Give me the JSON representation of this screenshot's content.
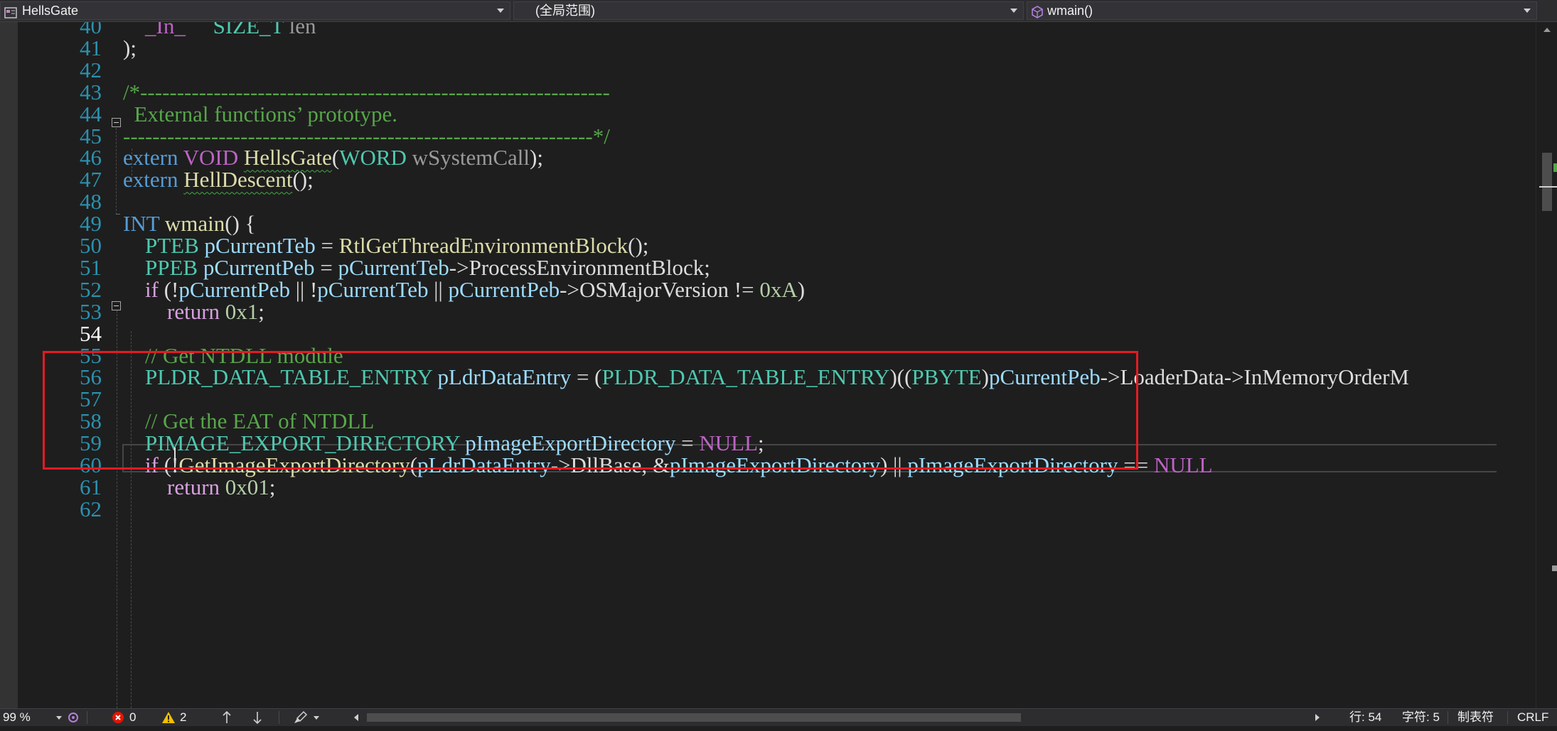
{
  "navbar": {
    "project": "HellsGate",
    "scope": "(全局范围)",
    "member": "wmain()"
  },
  "line_numbers": [
    "40",
    "41",
    "42",
    "43",
    "44",
    "45",
    "46",
    "47",
    "48",
    "49",
    "50",
    "51",
    "52",
    "53",
    "54",
    "55",
    "56",
    "57",
    "58",
    "59",
    "60",
    "61",
    "62"
  ],
  "current_line": "54",
  "code": [
    [
      {
        "t": "    _In_     ",
        "c": "macro"
      },
      {
        "t": "SIZE_T",
        "c": "type"
      },
      {
        "t": " len",
        "c": "param"
      }
    ],
    [
      {
        "t": ");",
        "c": "plain"
      }
    ],
    [],
    [
      {
        "t": "/*----------------------------------------------------------------",
        "c": "com"
      }
    ],
    [
      {
        "t": "  External functions’ prototype.",
        "c": "com"
      }
    ],
    [
      {
        "t": "----------------------------------------------------------------*/",
        "c": "com"
      }
    ],
    [
      {
        "t": "extern ",
        "c": "kw"
      },
      {
        "t": "VOID ",
        "c": "macro"
      },
      {
        "t": "HellsGate",
        "c": "func",
        "sq": true
      },
      {
        "t": "(",
        "c": "plain"
      },
      {
        "t": "WORD",
        "c": "type"
      },
      {
        "t": " wSystemCall",
        "c": "param"
      },
      {
        "t": ");",
        "c": "plain"
      }
    ],
    [
      {
        "t": "extern ",
        "c": "kw"
      },
      {
        "t": "HellDescent",
        "c": "func",
        "sq": true
      },
      {
        "t": "();",
        "c": "plain"
      }
    ],
    [],
    [
      {
        "t": "INT ",
        "c": "kw"
      },
      {
        "t": "wmain",
        "c": "func"
      },
      {
        "t": "() {",
        "c": "plain"
      }
    ],
    [
      {
        "t": "    PTEB ",
        "c": "type"
      },
      {
        "t": "pCurrentTeb",
        "c": "var"
      },
      {
        "t": " = ",
        "c": "plain"
      },
      {
        "t": "RtlGetThreadEnvironmentBlock",
        "c": "func"
      },
      {
        "t": "();",
        "c": "plain"
      }
    ],
    [
      {
        "t": "    PPEB ",
        "c": "type"
      },
      {
        "t": "pCurrentPeb",
        "c": "var"
      },
      {
        "t": " = ",
        "c": "plain"
      },
      {
        "t": "pCurrentTeb",
        "c": "var"
      },
      {
        "t": "->",
        "c": "plain"
      },
      {
        "t": "ProcessEnvironmentBlock",
        "c": "plain"
      },
      {
        "t": ";",
        "c": "plain"
      }
    ],
    [
      {
        "t": "    if ",
        "c": "ctrl"
      },
      {
        "t": "(!",
        "c": "plain"
      },
      {
        "t": "pCurrentPeb",
        "c": "var"
      },
      {
        "t": " || !",
        "c": "plain"
      },
      {
        "t": "pCurrentTeb",
        "c": "var"
      },
      {
        "t": " || ",
        "c": "plain"
      },
      {
        "t": "pCurrentPeb",
        "c": "var"
      },
      {
        "t": "->OSMajorVersion != ",
        "c": "plain"
      },
      {
        "t": "0xA",
        "c": "num"
      },
      {
        "t": ")",
        "c": "plain"
      }
    ],
    [
      {
        "t": "        return ",
        "c": "ctrl"
      },
      {
        "t": "0x1",
        "c": "num"
      },
      {
        "t": ";",
        "c": "plain"
      }
    ],
    [],
    [
      {
        "t": "    // Get NTDLL module",
        "c": "com"
      }
    ],
    [
      {
        "t": "    PLDR_DATA_TABLE_ENTRY ",
        "c": "type"
      },
      {
        "t": "pLdrDataEntry",
        "c": "var"
      },
      {
        "t": " = (",
        "c": "plain"
      },
      {
        "t": "PLDR_DATA_TABLE_ENTRY",
        "c": "type"
      },
      {
        "t": ")((",
        "c": "plain"
      },
      {
        "t": "PBYTE",
        "c": "type"
      },
      {
        "t": ")",
        "c": "plain"
      },
      {
        "t": "pCurrentPeb",
        "c": "var"
      },
      {
        "t": "->LoaderData->InMemoryOrderM",
        "c": "plain"
      }
    ],
    [],
    [
      {
        "t": "    // Get the EAT of NTDLL",
        "c": "com"
      }
    ],
    [
      {
        "t": "    PIMAGE_EXPORT_DIRECTORY ",
        "c": "type"
      },
      {
        "t": "pImageExportDirectory",
        "c": "var"
      },
      {
        "t": " = ",
        "c": "plain"
      },
      {
        "t": "NULL",
        "c": "macro"
      },
      {
        "t": ";",
        "c": "plain"
      }
    ],
    [
      {
        "t": "    if ",
        "c": "ctrl"
      },
      {
        "t": "(!",
        "c": "plain"
      },
      {
        "t": "GetImageExportDirectory",
        "c": "func"
      },
      {
        "t": "(",
        "c": "plain"
      },
      {
        "t": "pLdrDataEntry",
        "c": "var"
      },
      {
        "t": "->DllBase, &",
        "c": "plain"
      },
      {
        "t": "pImageExportDirectory",
        "c": "var"
      },
      {
        "t": ") || ",
        "c": "plain"
      },
      {
        "t": "pImageExportDirectory",
        "c": "var"
      },
      {
        "t": " == ",
        "c": "plain"
      },
      {
        "t": "NULL",
        "c": "macro"
      }
    ],
    [
      {
        "t": "        return ",
        "c": "ctrl"
      },
      {
        "t": "0x01",
        "c": "num"
      },
      {
        "t": ";",
        "c": "plain"
      }
    ],
    []
  ],
  "statusbar": {
    "zoom": "99 %",
    "errors": "0",
    "warnings": "2",
    "line": "行: 54",
    "char": "字符: 5",
    "indent": "制表符",
    "eol": "CRLF"
  },
  "colors": {
    "background": "#1e1e1e",
    "keyword": "#569cd6",
    "type": "#4ec9b0",
    "function": "#dcdcaa",
    "variable": "#9cdcfe",
    "comment": "#57a64a",
    "number": "#b5cea8",
    "highlight_box": "#e31b23"
  },
  "icons": [
    "project-icon",
    "member-cube-icon",
    "error-icon",
    "warning-icon",
    "arrow-up-icon",
    "arrow-down-icon",
    "brush-icon",
    "scroll-left-icon",
    "scroll-right-icon"
  ]
}
